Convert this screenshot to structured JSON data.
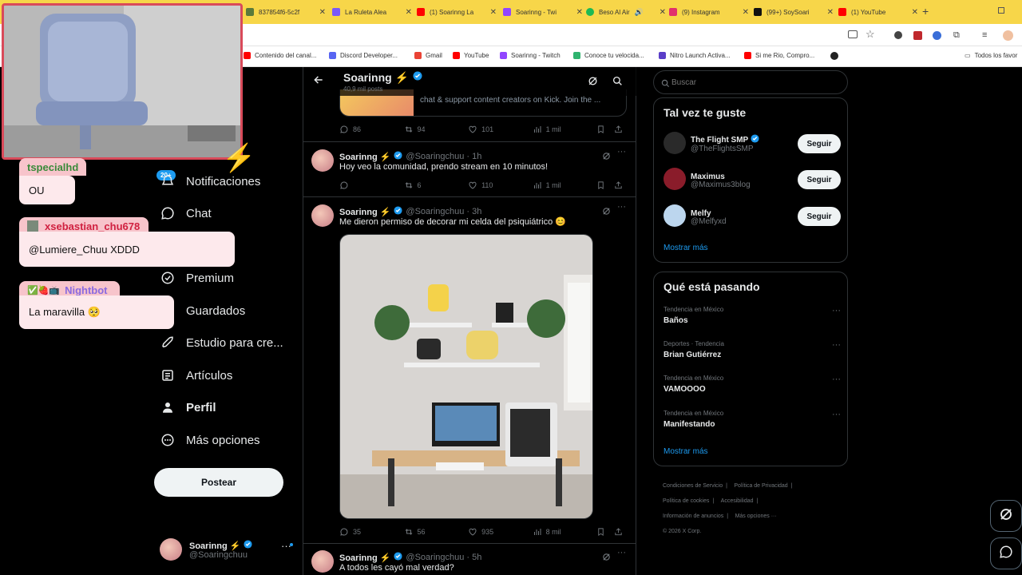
{
  "browser": {
    "tabs": [
      {
        "label": "837854f6-5c2f",
        "color": "#5a7a3a"
      },
      {
        "label": "La Ruleta Alea",
        "color": "#7a5af8"
      },
      {
        "label": "(1) Soarinng La",
        "color": "#ff0000"
      },
      {
        "label": "Soarinng - Twi",
        "color": "#9146ff"
      },
      {
        "label": "Beso Al Air",
        "color": "#1db954"
      },
      {
        "label": "(9) Instagram",
        "color": "#e1306c"
      },
      {
        "label": "(99+) SoySoari",
        "color": "#111111"
      },
      {
        "label": "(1) YouTube",
        "color": "#ff0000"
      }
    ],
    "new_tab": "+",
    "bookmarks": [
      {
        "label": "Contenido del canal...",
        "color": "#ff0000"
      },
      {
        "label": "Discord Developer...",
        "color": "#5865f2"
      },
      {
        "label": "Gmail",
        "color": "#ea4335"
      },
      {
        "label": "YouTube",
        "color": "#ff0000"
      },
      {
        "label": "Soarinng - Twitch",
        "color": "#9146ff"
      },
      {
        "label": "Conoce tu velocida...",
        "color": "#2fb36f"
      },
      {
        "label": "Nitro Launch Activa...",
        "color": "#5a3ec8"
      },
      {
        "label": "Si me Rio, Compro...",
        "color": "#ff0000"
      }
    ],
    "all_bookmarks": "Todos los favor"
  },
  "overlay_chat": [
    {
      "user": "tspecialhd",
      "user_color": "#3a8a3a",
      "message": "OU"
    },
    {
      "user": "xsebastian_chu678",
      "user_color": "#d02040",
      "message": "@Lumiere_Chuu XDDD"
    },
    {
      "user": "Nightbot",
      "user_color": "#8a6ae0",
      "message": "La maravilla 🥺"
    }
  ],
  "nav": {
    "notifications_badge": "20+",
    "items": [
      {
        "label": "Notificaciones",
        "icon": "bell-icon"
      },
      {
        "label": "Chat",
        "icon": "chat-icon"
      },
      {
        "label": "Premium",
        "icon": "premium-icon"
      },
      {
        "label": "Guardados",
        "icon": "bookmark-icon"
      },
      {
        "label": "Estudio para cre...",
        "icon": "rocket-icon"
      },
      {
        "label": "Artículos",
        "icon": "article-icon"
      },
      {
        "label": "Perfil",
        "icon": "person-icon"
      },
      {
        "label": "Más opciones",
        "icon": "more-icon"
      }
    ],
    "post_button": "Postear",
    "account_name": "Soarinng ⚡",
    "account_handle": "@Soaringchuu"
  },
  "profile_header": {
    "name": "Soarinng ⚡",
    "posts_count": "40,9 mil posts"
  },
  "pinned_card_text": "chat & support content creators on Kick. Join the ...",
  "posts": [
    {
      "replies": "86",
      "reposts": "94",
      "likes": "101",
      "views": "1 mil"
    },
    {
      "name": "Soarinng ⚡",
      "handle": "@Soaringchuu",
      "time": "· 1h",
      "text": "Hoy veo la comunidad, prendo stream en 10 minutos!",
      "replies": "",
      "reposts": "6",
      "likes": "110",
      "views": "1 mil"
    },
    {
      "name": "Soarinng ⚡",
      "handle": "@Soaringchuu",
      "time": "· 3h",
      "text": "Me dieron permiso de decorar mi celda del psiquiátrico 😊",
      "replies": "35",
      "reposts": "56",
      "likes": "935",
      "views": "8 mil"
    },
    {
      "name": "Soarinng ⚡",
      "handle": "@Soaringchuu",
      "time": "· 5h",
      "text": "A todos les cayó mal verdad?"
    }
  ],
  "search": {
    "placeholder": "Buscar"
  },
  "suggestions": {
    "title": "Tal vez te guste",
    "follow_label": "Seguir",
    "users": [
      {
        "name": "The Flight SMP",
        "handle": "@TheFlightsSMP",
        "avatar_color": "#2a2a2a"
      },
      {
        "name": "Maximus",
        "handle": "@Maximus3blog",
        "avatar_color": "#8a1c2a"
      },
      {
        "name": "Melfy",
        "handle": "@Melfyxd",
        "avatar_color": "#bcd6ee"
      }
    ],
    "show_more": "Mostrar más"
  },
  "trends": {
    "title": "Qué está pasando",
    "items": [
      {
        "meta": "Tendencia en México",
        "title": "Baños"
      },
      {
        "meta": "Deportes · Tendencia",
        "title": "Brian Gutiérrez"
      },
      {
        "meta": "Tendencia en México",
        "title": "VAMOOOO"
      },
      {
        "meta": "Tendencia en México",
        "title": "Manifestando"
      }
    ],
    "show_more": "Mostrar más"
  },
  "footer": {
    "links": [
      "Condiciones de Servicio",
      "Política de Privacidad",
      "Política de cookies",
      "Accesibilidad",
      "Información de anuncios",
      "Más opciones ···"
    ],
    "copyright": "© 2026 X Corp."
  },
  "colors": {
    "accent": "#1d9bf0",
    "background": "#000000",
    "border": "#2f3336",
    "tabbar": "#f7d649"
  }
}
